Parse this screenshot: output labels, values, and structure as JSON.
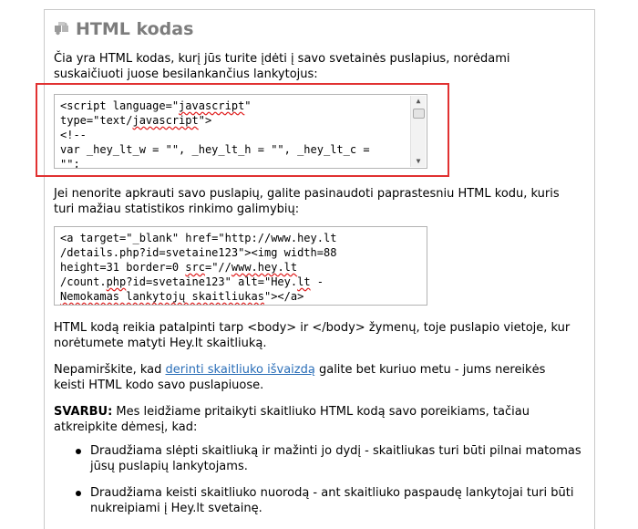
{
  "header": {
    "title": "HTML kodas",
    "icon": "puzzle-icon"
  },
  "intro": "Čia yra HTML kodas, kurį jūs turite įdėti į savo svetainės puslapius, norėdami suskaičiuoti juose besilankančius lankytojus:",
  "code1": {
    "line1_a": "<script language=\"",
    "line1_b": "javascript",
    "line1_c": "\"",
    "line2_a": "type=\"text/",
    "line2_b": "javascript",
    "line2_c": "\">",
    "line3": "<!--",
    "line4_a": "var _hey_lt_w = \"\", _hey_lt_h = \"\", _hey_lt_c =",
    "line5": "\"\";"
  },
  "alt_text": "Jei nenorite apkrauti savo puslapių, galite pasinaudoti paprastesniu HTML kodu, kuris turi mažiau statistikos rinkimo galimybių:",
  "code2": {
    "line1": "<a target=\"_blank\" href=\"http://www.hey.lt",
    "line2": "/details.php?id=svetaine123\"><img width=88",
    "line3_a": "height=31 border=0 ",
    "line3_b": "src",
    "line3_c": "=\"//",
    "line3_d": "www.hey.lt",
    "line4_a": "/count.",
    "line4_b": "php",
    "line4_c": "?id=svetaine123\" alt=\"Hey.",
    "line4_d": "lt",
    "line4_e": " -",
    "line5_a": "Nemokamas lankytojų skaitliukas",
    "line5_b": "\"></a>"
  },
  "placement": "HTML kodą reikia patalpinti tarp <body> ir </body> žymenų, toje puslapio vietoje, kur norėtumete matyti Hey.lt skaitliuką.",
  "reminder": {
    "before": "Nepamirškite, kad ",
    "link": "derinti skaitliuko išvaizdą",
    "after": " galite bet kuriuo metu - jums nereikės keisti HTML kodo savo puslapiuose."
  },
  "important": {
    "label": "SVARBU:",
    "text": " Mes leidžiame pritaikyti skaitliuko HTML kodą savo poreikiams, tačiau atkreipkite dėmesį, kad:"
  },
  "bullets": [
    "Draudžiama slėpti skaitliuką ir mažinti jo dydį - skaitliukas turi būti pilnai matomas jūsų puslapių lankytojams.",
    "Draudžiama keisti skaitliuko nuorodą - ant skaitliuko paspaudę lankytojai turi būti nukreipiami į Hey.lt svetainę."
  ],
  "colors": {
    "accent_red": "#e13131",
    "link": "#2a6eb8",
    "title": "#7d7d7d"
  }
}
